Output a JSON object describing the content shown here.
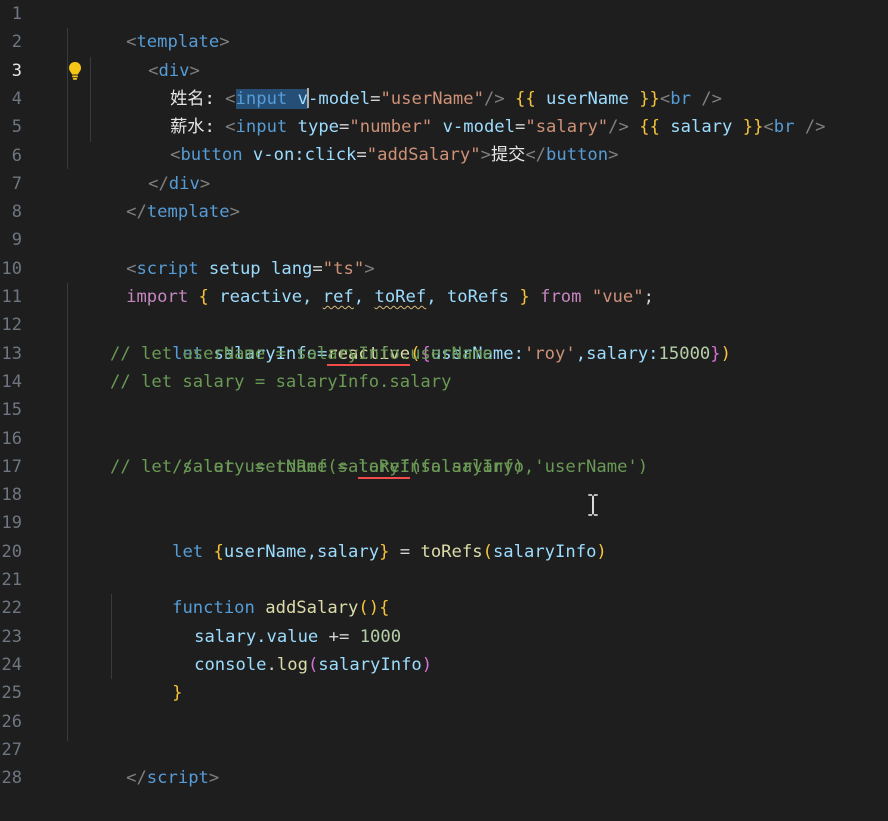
{
  "editor": {
    "active_line": 3,
    "line_numbers": [
      "1",
      "2",
      "3",
      "4",
      "5",
      "6",
      "7",
      "8",
      "9",
      "10",
      "11",
      "12",
      "13",
      "14",
      "15",
      "16",
      "17",
      "18",
      "19",
      "20",
      "21",
      "22",
      "23",
      "24",
      "25",
      "26",
      "27",
      "28"
    ],
    "icons": {
      "lightbulb": "lightbulb-icon",
      "text_cursor": "text-cursor-icon"
    }
  },
  "code": {
    "l1": [
      "<",
      "template",
      ">"
    ],
    "l2": [
      "<",
      "div",
      ">"
    ],
    "l3": [
      "姓名: ",
      "<",
      "input",
      " ",
      "v",
      "-model",
      "=",
      "\"userName\"",
      "/>",
      " ",
      "{{",
      " userName ",
      "}}",
      "<",
      "br",
      " />"
    ],
    "l4": [
      "薪水: ",
      "<",
      "input",
      " ",
      "type",
      "=",
      "\"number\"",
      " ",
      "v-model",
      "=",
      "\"salary\"",
      "/>",
      " ",
      "{{",
      " salary ",
      "}}",
      "<",
      "br",
      " />"
    ],
    "l5": [
      "<",
      "button",
      " ",
      "v-on:click",
      "=",
      "\"addSalary\"",
      ">",
      "提交",
      "</",
      "button",
      ">"
    ],
    "l6": [
      "</",
      "div",
      ">"
    ],
    "l7": [
      "</",
      "template",
      ">"
    ],
    "l9": [
      "<",
      "script",
      " ",
      "setup",
      " ",
      "lang",
      "=",
      "\"ts\"",
      ">"
    ],
    "l10": [
      "import",
      " ",
      "{",
      " reactive, ",
      "ref",
      ", ",
      "toRef",
      ", toRefs ",
      "}",
      " ",
      "from",
      " ",
      "\"vue\"",
      ";"
    ],
    "l12": [
      "let",
      " salaryInfo=",
      "reactive",
      "(",
      "{",
      "userName:",
      "'roy'",
      ",salary:",
      "15000",
      "}",
      ")"
    ],
    "l13": "// let userName = salaryInfo.userName",
    "l14": "// let salary = salaryInfo.salary",
    "l16": [
      "// let userName = ",
      "toRef",
      "(salaryInfo,'userName')"
    ],
    "l17": "// let salary = toRef(salaryInfo.salary)",
    "l19": [
      "let",
      " ",
      "{",
      "userName,salary",
      "}",
      " = ",
      "toRefs",
      "(",
      "salaryInfo",
      ")"
    ],
    "l21": [
      "function",
      " ",
      "addSalary",
      "()",
      "{"
    ],
    "l22": [
      "salary.value",
      " += ",
      "1000"
    ],
    "l23": [
      "console",
      ".",
      "log",
      "(",
      "salaryInfo",
      ")"
    ],
    "l24": [
      "}"
    ],
    "l27": [
      "</",
      "script",
      ">"
    ]
  }
}
